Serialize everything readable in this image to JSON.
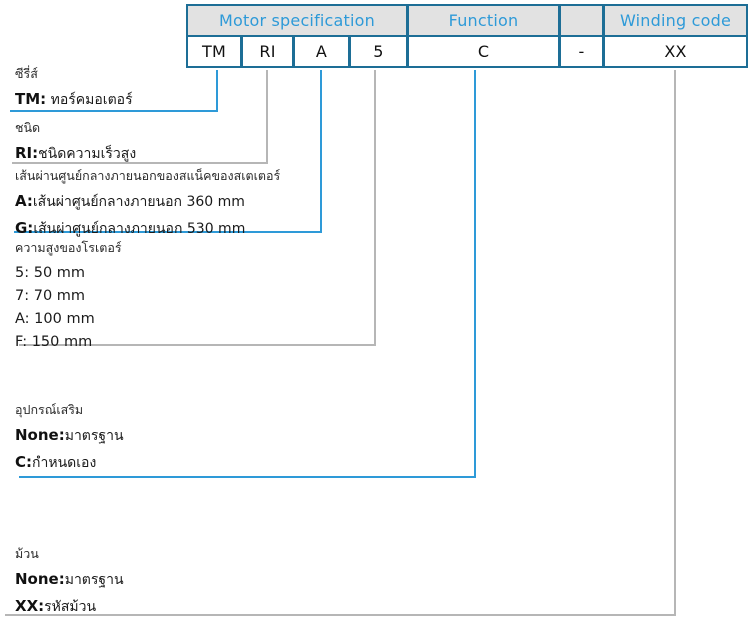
{
  "table": {
    "header": [
      {
        "label": "Motor specification",
        "name": "header-motor-specification"
      },
      {
        "label": "Function",
        "name": "header-function"
      },
      {
        "label": "",
        "name": "header-separator"
      },
      {
        "label": "Winding code",
        "name": "header-winding-code"
      }
    ],
    "values": [
      {
        "label": "TM",
        "name": "value-series"
      },
      {
        "label": "RI",
        "name": "value-type"
      },
      {
        "label": "A",
        "name": "value-stator-diameter"
      },
      {
        "label": "5",
        "name": "value-rotor-height"
      },
      {
        "label": "C",
        "name": "value-function"
      },
      {
        "label": "-",
        "name": "value-dash"
      },
      {
        "label": "XX",
        "name": "value-winding-code"
      }
    ]
  },
  "sections": {
    "series": {
      "title": "ซีรี่ส์",
      "items": [
        {
          "key": "TM:",
          "value": " ทอร์คมอเตอร์"
        }
      ]
    },
    "type": {
      "title": "ชนิด",
      "items": [
        {
          "key": "RI:",
          "value": "ชนิดความเร็วสูง"
        }
      ]
    },
    "stator_diameter": {
      "title": "เส้นผ่านศูนย์กลางภายนอกของสแน็คของสเตเตอร์",
      "items": [
        {
          "key": "A:",
          "value": "เส้นผ่าศูนย์กลางภายนอก 360 mm"
        },
        {
          "key": "G:",
          "value": "เส้นผ่าศูนย์กลางภายนอก 530 mm"
        }
      ]
    },
    "rotor_height": {
      "title": "ความสูงของโรเตอร์",
      "items": [
        {
          "text": "5: 50 mm"
        },
        {
          "text": "7: 70 mm"
        },
        {
          "text": "A: 100 mm"
        },
        {
          "text": "F: 150 mm"
        }
      ]
    },
    "accessory": {
      "title": "อุปกรณ์เสริม",
      "items": [
        {
          "key": "None:",
          "value": "มาตรฐาน"
        },
        {
          "key": "C:",
          "value": "กำหนดเอง"
        }
      ]
    },
    "winding": {
      "title": "ม้วน",
      "items": [
        {
          "key": "None:",
          "value": "มาตรฐาน"
        },
        {
          "key": "XX:",
          "value": "รหัสม้วน"
        }
      ]
    }
  },
  "colors": {
    "header_text": "#2e9ad8",
    "header_bg": "#e2e2e2",
    "border": "#1d6e96",
    "connector_blue": "#2e9ad8",
    "connector_gray": "#b6b6b6"
  }
}
